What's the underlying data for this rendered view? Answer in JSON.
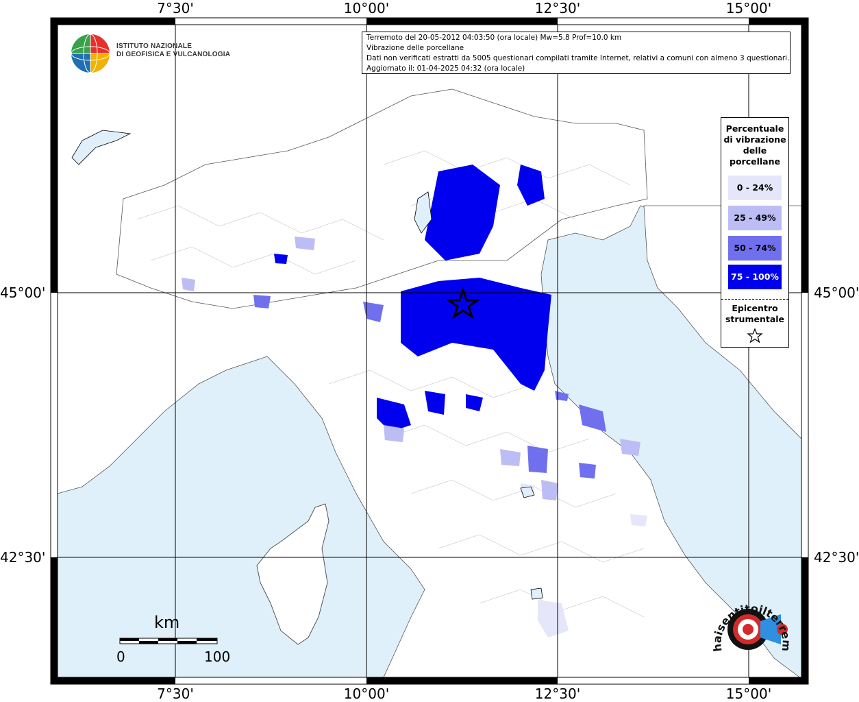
{
  "map": {
    "top_labels": [
      "7°30'",
      "10°00'",
      "12°30'",
      "15°00'"
    ],
    "bottom_labels": [
      "7°30'",
      "10°00'",
      "12°30'",
      "15°00'"
    ],
    "left_labels": [
      "45°00'",
      "42°30'"
    ],
    "right_labels": [
      "45°00'",
      "42°30'"
    ],
    "colors": {
      "sea": "#dff0fa",
      "land": "#ffffff",
      "border": "#000000",
      "grid": "#000000",
      "class_0_24": "#e6e6fa",
      "class_25_49": "#bdbdf5",
      "class_50_74": "#7070ee",
      "class_75_100": "#0000ee"
    }
  },
  "info": {
    "line1": "Terremoto del 20-05-2012 04:03:50 (ora locale) Mw=5.8 Prof=10.0 km",
    "line2": "Vibrazione delle porcellane",
    "line3": "Dati non verificati estratti da 5005 questionari compilati tramite Internet, relativi a comuni con almeno 3 questionari.",
    "line4": "Aggiornato il: 01-04-2025 04:32 (ora locale)"
  },
  "legend": {
    "title_line1": "Percentuale",
    "title_line2": "di vibrazione",
    "title_line3": "delle",
    "title_line4": "porcellane",
    "classes": [
      "0 - 24%",
      "25 - 49%",
      "50 - 74%",
      "75 - 100%"
    ],
    "epicenter_line1": "Epicentro",
    "epicenter_line2": "strumentale",
    "star_icon": "star-outline-icon"
  },
  "logo": {
    "line1": "ISTITUTO NAZIONALE",
    "line2": "DI GEOFISICA E VULCANOLOGIA"
  },
  "scale": {
    "unit": "km",
    "start": "0",
    "end": "100"
  },
  "watermark": {
    "text": "www.haisentitoilterremoto.it"
  }
}
